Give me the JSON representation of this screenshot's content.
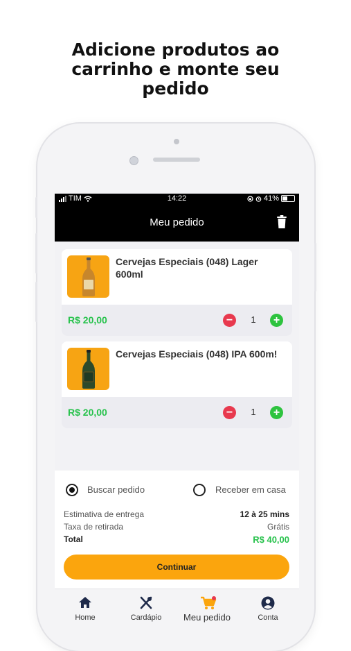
{
  "headline": {
    "line1": "Adicione produtos ao",
    "line2": "carrinho e monte seu",
    "line3": "pedido"
  },
  "status_bar": {
    "carrier": "TIM",
    "time": "14:22",
    "battery": "41%"
  },
  "nav": {
    "title": "Meu pedido",
    "trash_icon": "trash-icon"
  },
  "cart": {
    "items": [
      {
        "name": "Cervejas Especiais (048) Lager 600ml",
        "price": "R$ 20,00",
        "quantity": "1",
        "bottle_color": "#c7862c"
      },
      {
        "name": "Cervejas Especiais (048) IPA 600m!",
        "price": "R$ 20,00",
        "quantity": "1",
        "bottle_color": "#2d4a2b"
      }
    ],
    "minus_label": "−",
    "plus_label": "+"
  },
  "delivery": {
    "options": [
      {
        "label": "Buscar pedido",
        "selected": true
      },
      {
        "label": "Receber em casa",
        "selected": false
      }
    ],
    "estimate_label": "Estimativa de entrega",
    "estimate_value": "12 à 25 mins",
    "fee_label": "Taxa de retirada",
    "fee_value": "Grátis",
    "total_label": "Total",
    "total_value": "R$ 40,00",
    "continue_label": "Continuar"
  },
  "tabs": [
    {
      "label": "Home",
      "icon": "home-icon"
    },
    {
      "label": "Cardápio",
      "icon": "fork-knife-icon"
    },
    {
      "label": "Meu pedido",
      "icon": "cart-icon",
      "active": true
    },
    {
      "label": "Conta",
      "icon": "account-icon"
    }
  ],
  "colors": {
    "accent": "#fba50d",
    "price_green": "#27c24c",
    "minus_red": "#e8394e",
    "plus_green": "#2ec33f",
    "header_black": "#000000"
  }
}
